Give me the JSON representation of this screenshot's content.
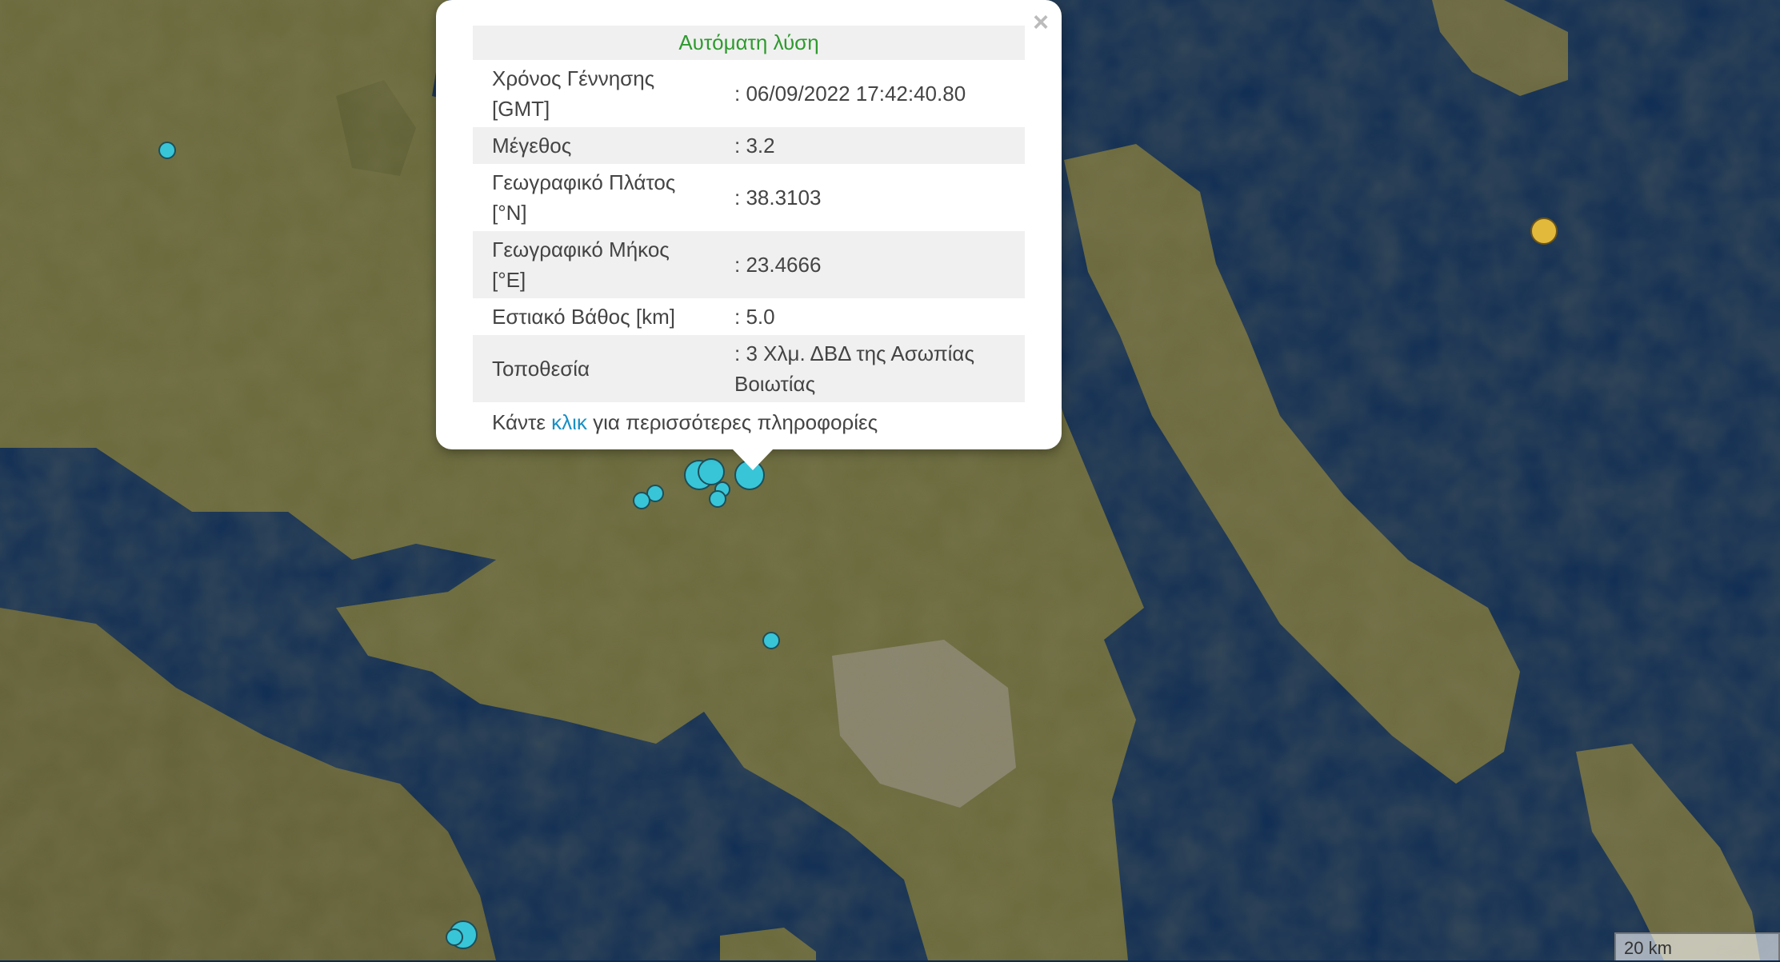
{
  "popup": {
    "title": "Αυτόματη λύση",
    "close": "×",
    "rows": [
      {
        "label": "Χρόνος Γέννησης [GMT]",
        "value": ": 06/09/2022 17:42:40.80"
      },
      {
        "label": "Μέγεθος",
        "value": ": 3.2"
      },
      {
        "label": "Γεωγραφικό Πλάτος [°N]",
        "value": ": 38.3103"
      },
      {
        "label": "Γεωγραφικό Μήκος [°E]",
        "value": ": 23.4666"
      },
      {
        "label": "Εστιακό Βάθος [km]",
        "value": ": 5.0"
      },
      {
        "label": "Τοποθεσία",
        "value": ": 3 Χλμ. ΔΒΔ της Ασωπίας Βοιωτίας"
      }
    ],
    "more_prefix": "Κάντε ",
    "more_link": "κλικ",
    "more_suffix": " για περισσότερες πληροφορίες"
  },
  "scale_label": "20 km",
  "colors": {
    "quake": "#38c5d8",
    "recent_quake": "#e2b93b",
    "sea": "#0c2a52",
    "land": "#6b6a3a"
  }
}
